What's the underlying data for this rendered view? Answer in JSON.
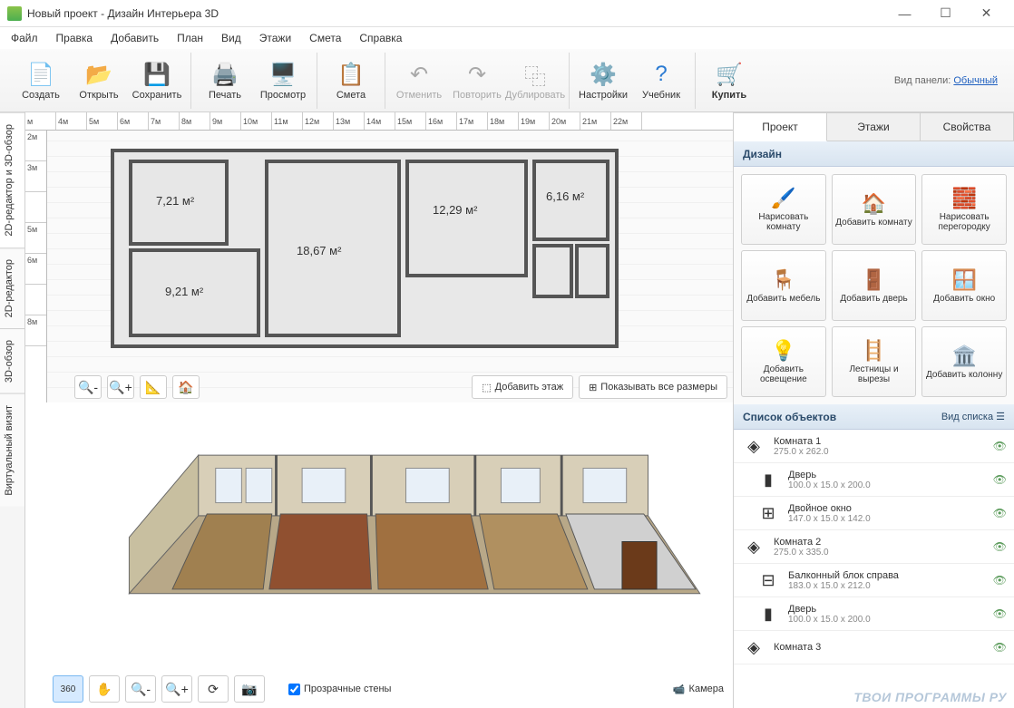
{
  "window": {
    "title": "Новый проект - Дизайн Интерьера 3D"
  },
  "menu": [
    "Файл",
    "Правка",
    "Добавить",
    "План",
    "Вид",
    "Этажи",
    "Смета",
    "Справка"
  ],
  "toolbar": {
    "create": "Создать",
    "open": "Открыть",
    "save": "Сохранить",
    "print": "Печать",
    "preview": "Просмотр",
    "estimate": "Смета",
    "undo": "Отменить",
    "redo": "Повторить",
    "duplicate": "Дублировать",
    "settings": "Настройки",
    "tutorial": "Учебник",
    "buy": "Купить"
  },
  "panel_mode": {
    "label": "Вид панели:",
    "value": "Обычный"
  },
  "side_tabs": [
    "2D-редактор и 3D-обзор",
    "2D-редактор",
    "3D-обзор",
    "Виртуальный визит"
  ],
  "ruler_h": [
    "м",
    "4м",
    "5м",
    "6м",
    "7м",
    "8м",
    "9м",
    "10м",
    "11м",
    "12м",
    "13м",
    "14м",
    "15м",
    "16м",
    "17м",
    "18м",
    "19м",
    "20м",
    "21м",
    "22м"
  ],
  "ruler_v": [
    "2м",
    "3м",
    "",
    "5м",
    "6м",
    "",
    "8м"
  ],
  "rooms": {
    "r1": "7,21 м²",
    "r2": "18,67 м²",
    "r3": "12,29 м²",
    "r4": "6,16 м²",
    "r5": "9,21 м²"
  },
  "plan_buttons": {
    "add_floor": "Добавить этаж",
    "show_sizes": "Показывать все размеры"
  },
  "view3d": {
    "transparent_walls": "Прозрачные стены",
    "camera": "Камера",
    "rotate360": "360"
  },
  "right": {
    "tabs": [
      "Проект",
      "Этажи",
      "Свойства"
    ],
    "design_header": "Дизайн",
    "tools": [
      "Нарисовать комнату",
      "Добавить комнату",
      "Нарисовать перегородку",
      "Добавить мебель",
      "Добавить дверь",
      "Добавить окно",
      "Добавить освещение",
      "Лестницы и вырезы",
      "Добавить колонну"
    ],
    "objects_header": "Список объектов",
    "list_mode": "Вид списка",
    "objects": [
      {
        "name": "Комната 1",
        "dim": "275.0 x 262.0",
        "icon": "◈",
        "child": false
      },
      {
        "name": "Дверь",
        "dim": "100.0 x 15.0 x 200.0",
        "icon": "▮",
        "child": true
      },
      {
        "name": "Двойное окно",
        "dim": "147.0 x 15.0 x 142.0",
        "icon": "⊞",
        "child": true
      },
      {
        "name": "Комната 2",
        "dim": "275.0 x 335.0",
        "icon": "◈",
        "child": false
      },
      {
        "name": "Балконный блок справа",
        "dim": "183.0 x 15.0 x 212.0",
        "icon": "⊟",
        "child": true
      },
      {
        "name": "Дверь",
        "dim": "100.0 x 15.0 x 200.0",
        "icon": "▮",
        "child": true
      },
      {
        "name": "Комната 3",
        "dim": "",
        "icon": "◈",
        "child": false
      }
    ]
  },
  "watermark": "ТВОИ ПРОГРАММЫ РУ"
}
